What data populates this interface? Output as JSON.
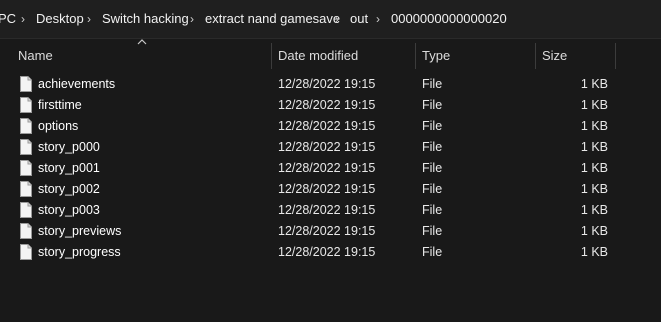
{
  "breadcrumb": {
    "items": [
      "PC",
      "Desktop",
      "Switch hacking",
      "extract nand gamesave",
      "out",
      "0000000000000020"
    ],
    "separator": "›"
  },
  "columns": {
    "name": "Name",
    "date": "Date modified",
    "type": "Type",
    "size": "Size"
  },
  "sort": {
    "column": "Name",
    "direction": "ascending"
  },
  "files": [
    {
      "name": "achievements",
      "date": "12/28/2022 19:15",
      "type": "File",
      "size": "1 KB"
    },
    {
      "name": "firsttime",
      "date": "12/28/2022 19:15",
      "type": "File",
      "size": "1 KB"
    },
    {
      "name": "options",
      "date": "12/28/2022 19:15",
      "type": "File",
      "size": "1 KB"
    },
    {
      "name": "story_p000",
      "date": "12/28/2022 19:15",
      "type": "File",
      "size": "1 KB"
    },
    {
      "name": "story_p001",
      "date": "12/28/2022 19:15",
      "type": "File",
      "size": "1 KB"
    },
    {
      "name": "story_p002",
      "date": "12/28/2022 19:15",
      "type": "File",
      "size": "1 KB"
    },
    {
      "name": "story_p003",
      "date": "12/28/2022 19:15",
      "type": "File",
      "size": "1 KB"
    },
    {
      "name": "story_previews",
      "date": "12/28/2022 19:15",
      "type": "File",
      "size": "1 KB"
    },
    {
      "name": "story_progress",
      "date": "12/28/2022 19:15",
      "type": "File",
      "size": "1 KB"
    }
  ],
  "icons": {
    "file": "file-icon",
    "separator": "chevron-right-icon",
    "sort": "sort-up-icon"
  },
  "colors": {
    "background": "#191919",
    "addressbar": "#1f1f1f",
    "text": "#ffffff"
  }
}
